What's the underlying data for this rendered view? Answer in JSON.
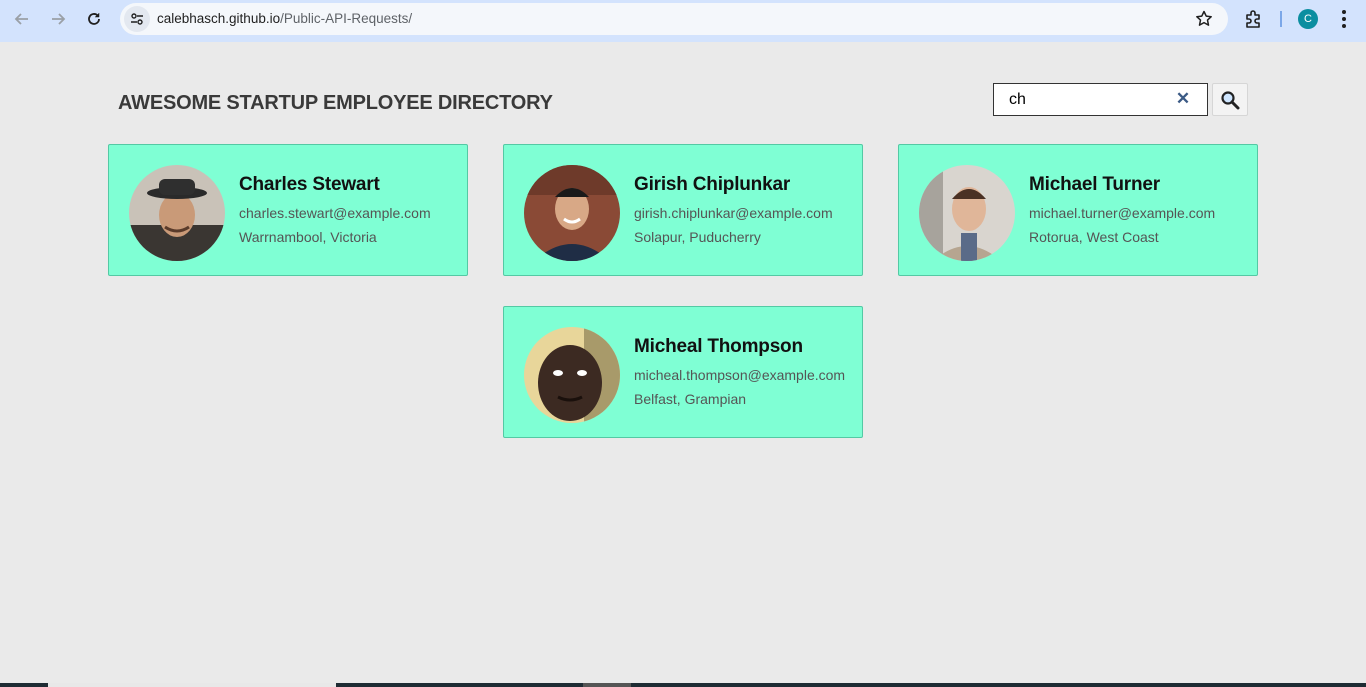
{
  "browser": {
    "url_host": "calebhasch.github.io",
    "url_path": "/Public-API-Requests/",
    "profile_initial": "C"
  },
  "page": {
    "title": "AWESOME STARTUP EMPLOYEE DIRECTORY"
  },
  "search": {
    "value": "ch",
    "clear_symbol": "✕"
  },
  "employees": [
    {
      "name": "Charles Stewart",
      "email": "charles.stewart@example.com",
      "location": "Warrnambool, Victoria"
    },
    {
      "name": "Girish Chiplunkar",
      "email": "girish.chiplunkar@example.com",
      "location": "Solapur, Puducherry"
    },
    {
      "name": "Michael Turner",
      "email": "michael.turner@example.com",
      "location": "Rotorua, West Coast"
    },
    {
      "name": "Micheal Thompson",
      "email": "micheal.thompson@example.com",
      "location": "Belfast, Grampian"
    }
  ],
  "colors": {
    "card_bg": "#7fffd4",
    "page_bg": "#eaeaea",
    "chrome_bg": "#d3e3fd"
  }
}
